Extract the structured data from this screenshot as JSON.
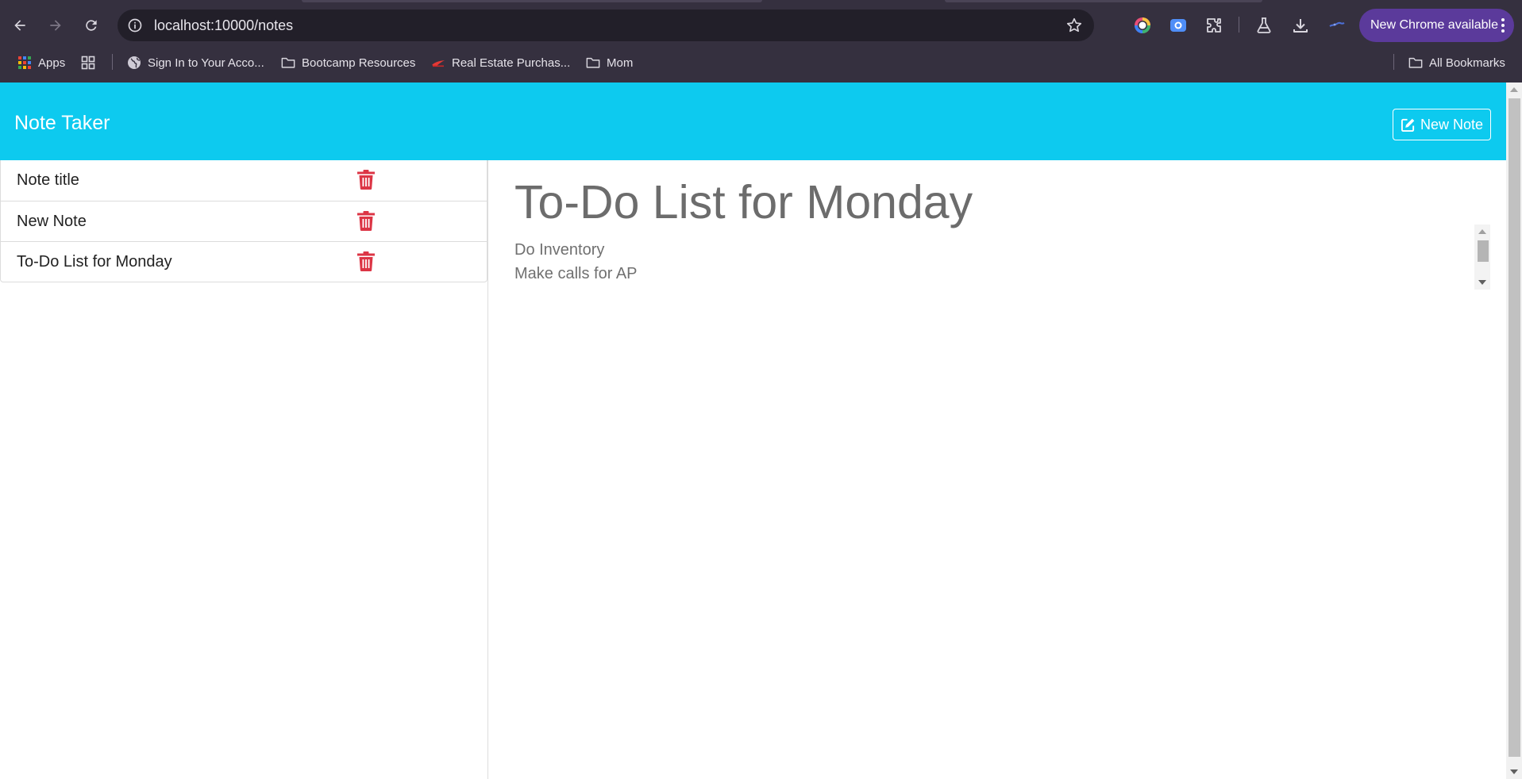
{
  "browser": {
    "url": "localhost:10000/notes",
    "update_label": "New Chrome available",
    "bookmarks": [
      {
        "label": "Apps",
        "icon": "apps-grid-icon"
      },
      {
        "label": "Sign In to Your Acco...",
        "icon": "globe-icon"
      },
      {
        "label": "Bootcamp Resources",
        "icon": "folder-icon"
      },
      {
        "label": "Real Estate Purchas...",
        "icon": "site-favicon-icon"
      },
      {
        "label": "Mom",
        "icon": "folder-icon"
      }
    ],
    "all_bookmarks_label": "All Bookmarks",
    "colors": {
      "chrome_bg": "#35303f",
      "omnibox_bg": "#221f29",
      "update_pill": "#5b3a9b"
    }
  },
  "app": {
    "title": "Note Taker",
    "new_note_label": "New Note",
    "colors": {
      "header_bg": "#0dcaef",
      "trash": "#dc3545"
    }
  },
  "notes": [
    {
      "title": "Note title"
    },
    {
      "title": "New Note"
    },
    {
      "title": "To-Do List for Monday"
    }
  ],
  "editor": {
    "title": "To-Do List for Monday",
    "body_lines": [
      "Do Inventory",
      "Make calls for AP"
    ]
  }
}
